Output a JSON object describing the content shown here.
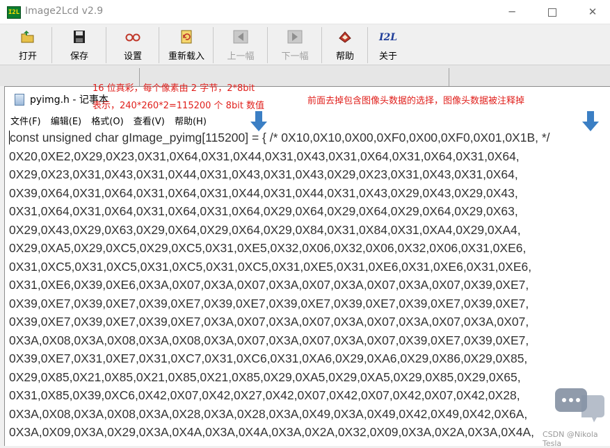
{
  "app": {
    "icon_text": "I2L",
    "title": "Image2Lcd v2.9",
    "window_controls": {
      "minimize": "─",
      "close": "✕"
    }
  },
  "toolbar": {
    "buttons": [
      {
        "label": "打开",
        "icon": "folder-open-icon"
      },
      {
        "label": "保存",
        "icon": "floppy-disk-icon"
      },
      {
        "label": "设置",
        "icon": "glasses-icon"
      },
      {
        "label": "重新载入",
        "icon": "reload-icon"
      },
      {
        "label": "上一幅",
        "icon": "previous-arrow-icon",
        "disabled": true
      },
      {
        "label": "下一幅",
        "icon": "next-arrow-icon",
        "disabled": true
      },
      {
        "label": "帮助",
        "icon": "help-book-icon"
      },
      {
        "label": "关于",
        "icon": "i2l-logo-icon"
      }
    ]
  },
  "notepad": {
    "title": "pyimg.h - 记事本",
    "menu": [
      "文件(F)",
      "编辑(E)",
      "格式(O)",
      "查看(V)",
      "帮助(H)"
    ],
    "lines": [
      "const unsigned char gImage_pyimg[115200] = { /* 0X10,0X10,0X00,0XF0,0X00,0XF0,0X01,0X1B, */",
      "0X20,0XE2,0X29,0X23,0X31,0X64,0X31,0X44,0X31,0X43,0X31,0X64,0X31,0X64,0X31,0X64,",
      "0X29,0X23,0X31,0X43,0X31,0X44,0X31,0X43,0X31,0X43,0X29,0X23,0X31,0X43,0X31,0X64,",
      "0X39,0X64,0X31,0X64,0X31,0X64,0X31,0X44,0X31,0X44,0X31,0X43,0X29,0X43,0X29,0X43,",
      "0X31,0X64,0X31,0X64,0X31,0X64,0X31,0X64,0X29,0X64,0X29,0X64,0X29,0X64,0X29,0X63,",
      "0X29,0X43,0X29,0X63,0X29,0X64,0X29,0X64,0X29,0X84,0X31,0X84,0X31,0XA4,0X29,0XA4,",
      "0X29,0XA5,0X29,0XC5,0X29,0XC5,0X31,0XE5,0X32,0X06,0X32,0X06,0X32,0X06,0X31,0XE6,",
      "0X31,0XC5,0X31,0XC5,0X31,0XC5,0X31,0XC5,0X31,0XE5,0X31,0XE6,0X31,0XE6,0X31,0XE6,",
      "0X31,0XE6,0X39,0XE6,0X3A,0X07,0X3A,0X07,0X3A,0X07,0X3A,0X07,0X3A,0X07,0X39,0XE7,",
      "0X39,0XE7,0X39,0XE7,0X39,0XE7,0X39,0XE7,0X39,0XE7,0X39,0XE7,0X39,0XE7,0X39,0XE7,",
      "0X39,0XE7,0X39,0XE7,0X39,0XE7,0X3A,0X07,0X3A,0X07,0X3A,0X07,0X3A,0X07,0X3A,0X07,",
      "0X3A,0X08,0X3A,0X08,0X3A,0X08,0X3A,0X07,0X3A,0X07,0X3A,0X07,0X39,0XE7,0X39,0XE7,",
      "0X39,0XE7,0X31,0XE7,0X31,0XC7,0X31,0XC6,0X31,0XA6,0X29,0XA6,0X29,0X86,0X29,0X85,",
      "0X29,0X85,0X21,0X85,0X21,0X85,0X21,0X85,0X29,0XA5,0X29,0XA5,0X29,0X85,0X29,0X65,",
      "0X31,0X85,0X39,0XC6,0X42,0X07,0X42,0X27,0X42,0X07,0X42,0X07,0X42,0X07,0X42,0X28,",
      "0X3A,0X08,0X3A,0X08,0X3A,0X28,0X3A,0X28,0X3A,0X49,0X3A,0X49,0X42,0X49,0X42,0X6A,",
      "0X3A,0X09,0X3A,0X29,0X3A,0X4A,0X3A,0X4A,0X3A,0X2A,0X32,0X09,0X3A,0X2A,0X3A,0X4A,"
    ]
  },
  "annotations": {
    "left_line1": "16 位真彩，每个像素由 2 字节，2*8bit",
    "left_line2": "表示，240*260*2=115200 个 8bit 数值",
    "right": "前面去掉包含图像头数据的选择，图像头数据被注释掉",
    "color": "#e0201c",
    "arrow_color": "#3b7fc4"
  },
  "watermark": {
    "text": "CSDN @Nikola Tesla"
  }
}
